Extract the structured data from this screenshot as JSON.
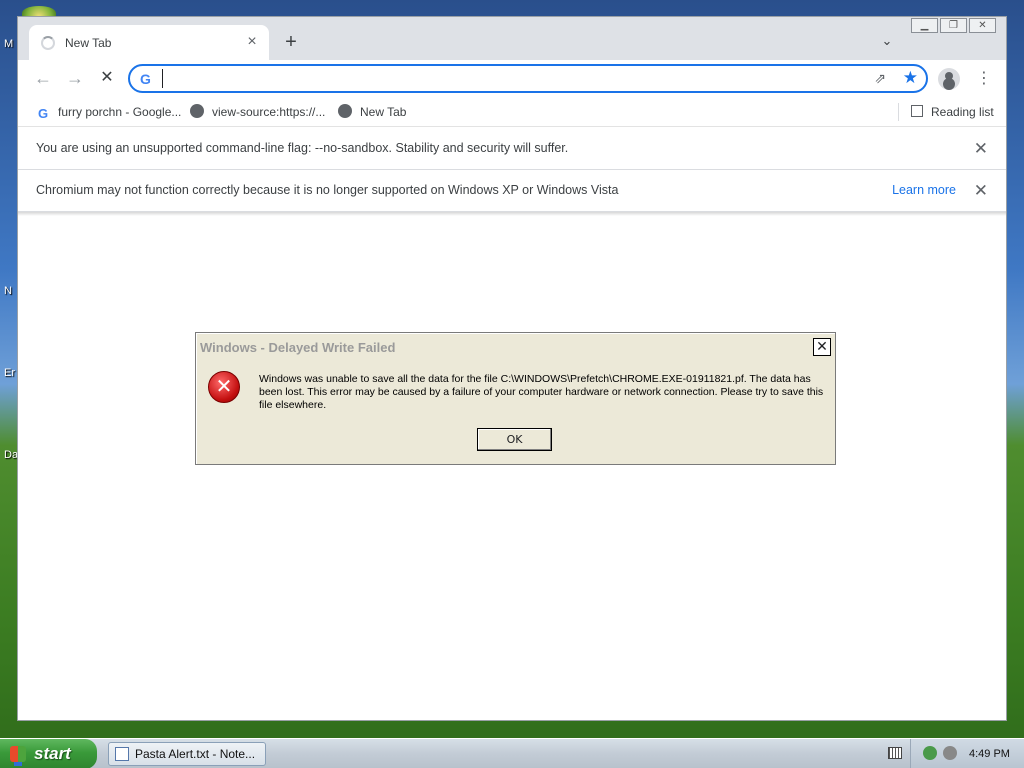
{
  "desktop": {
    "labels": [
      "M",
      "N",
      "Er",
      "Da"
    ]
  },
  "browser": {
    "tab": {
      "title": "New Tab",
      "close": "×"
    },
    "new_tab": "+",
    "tab_search": "⌄",
    "window_controls": {
      "minimize": "▁",
      "restore": "❐",
      "close": "✕"
    },
    "toolbar": {
      "back": "←",
      "forward": "→",
      "stop": "✕",
      "search_engine_icon": "G",
      "address_value": "",
      "share": "⇗",
      "star": "★",
      "menu": "⋮"
    },
    "bookmarks": [
      {
        "label": "furry porchn - Google...",
        "icon": "google-icon"
      },
      {
        "label": "view-source:https://...",
        "icon": "globe-icon"
      },
      {
        "label": "New Tab",
        "icon": "globe-icon"
      }
    ],
    "reading_list": "Reading list",
    "infobars": [
      {
        "text": "You are using an unsupported command-line flag: --no-sandbox. Stability and security will suffer.",
        "link": ""
      },
      {
        "text": "Chromium may not function correctly because it is no longer supported on Windows XP or Windows Vista",
        "link": "Learn more"
      }
    ],
    "infobar_close": "✕"
  },
  "dialog": {
    "title": "Windows - Delayed Write Failed",
    "close": "✕",
    "icon": "error-icon",
    "icon_glyph": "✕",
    "message": "Windows was unable to save all the data for the file C:\\WINDOWS\\Prefetch\\CHROME.EXE-01911821.pf. The data has been lost. This error may be caused by a failure of your computer hardware or network connection. Please try to save this file elsewhere.",
    "ok": "OK"
  },
  "taskbar": {
    "start": "start",
    "items": [
      {
        "label": "Pasta Alert.txt - Note..."
      }
    ],
    "clock": "4:49 PM"
  }
}
